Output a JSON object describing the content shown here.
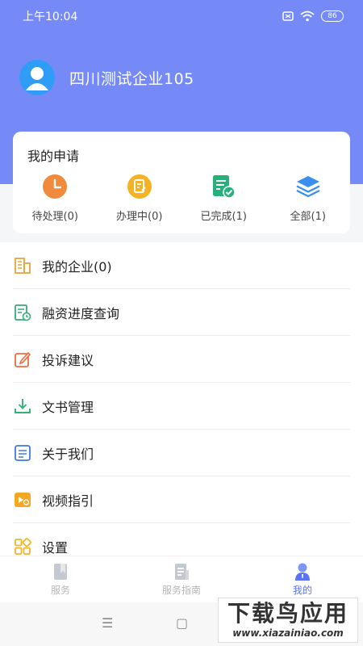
{
  "status_bar": {
    "time": "上午10:04",
    "battery": "86"
  },
  "profile": {
    "company_name": "四川测试企业105"
  },
  "my_applications": {
    "title": "我的申请",
    "items": [
      {
        "label": "待处理(0)",
        "icon": "clock-icon",
        "color": "#f08a3c"
      },
      {
        "label": "办理中(0)",
        "icon": "edit-doc-icon",
        "color": "#f5b324"
      },
      {
        "label": "已完成(1)",
        "icon": "doc-check-icon",
        "color": "#27b07c"
      },
      {
        "label": "全部(1)",
        "icon": "layers-icon",
        "color": "#3a8ef0"
      }
    ]
  },
  "menu": [
    {
      "label": "我的企业(0)",
      "icon": "building-icon",
      "color": "#e7a43c"
    },
    {
      "label": "融资进度查询",
      "icon": "doc-clock-icon",
      "color": "#3aa97a"
    },
    {
      "label": "投诉建议",
      "icon": "edit-icon",
      "color": "#ef6b3b"
    },
    {
      "label": "文书管理",
      "icon": "download-icon",
      "color": "#33b07a"
    },
    {
      "label": "关于我们",
      "icon": "list-doc-icon",
      "color": "#3f78e0"
    },
    {
      "label": "视频指引",
      "icon": "video-icon",
      "color": "#f5a623"
    },
    {
      "label": "设置",
      "icon": "grid-icon",
      "color": "#f0b429"
    }
  ],
  "tabbar": [
    {
      "label": "服务",
      "icon": "service-icon",
      "active": false
    },
    {
      "label": "服务指南",
      "icon": "guide-icon",
      "active": false
    },
    {
      "label": "我的",
      "icon": "user-icon",
      "active": true
    }
  ],
  "watermark": {
    "title": "下载鸟应用",
    "url": "www.xiazainiao.com"
  }
}
